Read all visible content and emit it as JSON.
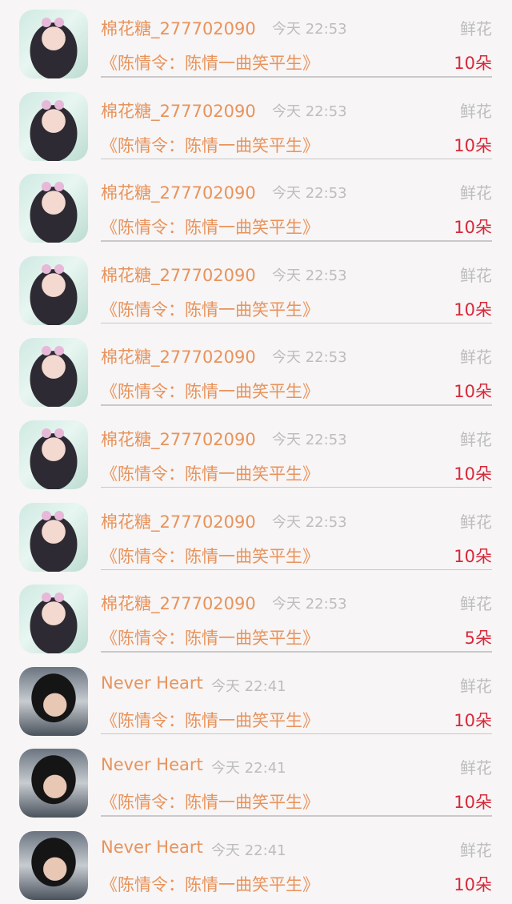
{
  "items": [
    {
      "name": "棉花糖_277702090",
      "time": "今天 22:53",
      "gift_type": "鲜花",
      "title": "《陈情令：陈情一曲笑平生》",
      "count": "10朵",
      "avatar": "a"
    },
    {
      "name": "棉花糖_277702090",
      "time": "今天 22:53",
      "gift_type": "鲜花",
      "title": "《陈情令：陈情一曲笑平生》",
      "count": "10朵",
      "avatar": "a"
    },
    {
      "name": "棉花糖_277702090",
      "time": "今天 22:53",
      "gift_type": "鲜花",
      "title": "《陈情令：陈情一曲笑平生》",
      "count": "10朵",
      "avatar": "a"
    },
    {
      "name": "棉花糖_277702090",
      "time": "今天 22:53",
      "gift_type": "鲜花",
      "title": "《陈情令：陈情一曲笑平生》",
      "count": "10朵",
      "avatar": "a"
    },
    {
      "name": "棉花糖_277702090",
      "time": "今天 22:53",
      "gift_type": "鲜花",
      "title": "《陈情令：陈情一曲笑平生》",
      "count": "10朵",
      "avatar": "a"
    },
    {
      "name": "棉花糖_277702090",
      "time": "今天 22:53",
      "gift_type": "鲜花",
      "title": "《陈情令：陈情一曲笑平生》",
      "count": "10朵",
      "avatar": "a"
    },
    {
      "name": "棉花糖_277702090",
      "time": "今天 22:53",
      "gift_type": "鲜花",
      "title": "《陈情令：陈情一曲笑平生》",
      "count": "10朵",
      "avatar": "a"
    },
    {
      "name": "棉花糖_277702090",
      "time": "今天 22:53",
      "gift_type": "鲜花",
      "title": "《陈情令：陈情一曲笑平生》",
      "count": "5朵",
      "avatar": "a"
    },
    {
      "name": "Never Heart",
      "time": "今天 22:41",
      "gift_type": "鲜花",
      "title": "《陈情令：陈情一曲笑平生》",
      "count": "10朵",
      "avatar": "b"
    },
    {
      "name": "Never Heart",
      "time": "今天 22:41",
      "gift_type": "鲜花",
      "title": "《陈情令：陈情一曲笑平生》",
      "count": "10朵",
      "avatar": "b"
    },
    {
      "name": "Never Heart",
      "time": "今天 22:41",
      "gift_type": "鲜花",
      "title": "《陈情令：陈情一曲笑平生》",
      "count": "10朵",
      "avatar": "b"
    }
  ]
}
